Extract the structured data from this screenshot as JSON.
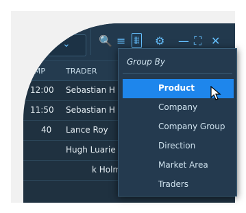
{
  "toolbar": {
    "dropdown_icon": "chevron-down",
    "search_icon": "🔍",
    "list_icon": "≡",
    "filter_icon": "⩩",
    "settings_icon": "⚙",
    "minimize_icon": "—",
    "expand_icon": "⛶",
    "close_icon": "✕"
  },
  "grid": {
    "headers": [
      "AMP",
      "TRADER"
    ],
    "rows": [
      {
        "time": "12:00",
        "trader": "Sebastian H"
      },
      {
        "time": "11:50",
        "trader": "Sebastian H"
      },
      {
        "time": "40",
        "trader": "Lance Roy"
      },
      {
        "time": "",
        "trader": "Hugh Luarie"
      },
      {
        "time": "",
        "trader": "k Holmes"
      }
    ]
  },
  "menu": {
    "title": "Group By",
    "items": [
      "Product",
      "Company",
      "Company Group",
      "Direction",
      "Market Area",
      "Traders"
    ],
    "selected": "Product"
  },
  "colors": {
    "accent": "#66c1ff",
    "selected": "#1e86ec",
    "background": "#1f3140"
  }
}
